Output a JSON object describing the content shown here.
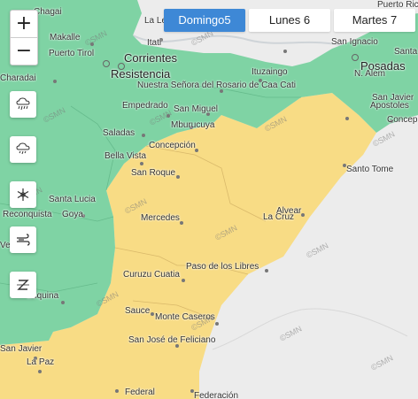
{
  "tabs": [
    {
      "label": "Domingo5",
      "active": true
    },
    {
      "label": "Lunes 6",
      "active": false
    },
    {
      "label": "Martes 7",
      "active": false
    }
  ],
  "zoom": {
    "in_label": "+",
    "out_label": "−"
  },
  "hazard_buttons": [
    {
      "icon": "rain-icon"
    },
    {
      "icon": "storm-icon"
    },
    {
      "icon": "snow-icon"
    },
    {
      "icon": "wind-icon"
    },
    {
      "icon": "zonda-icon"
    }
  ],
  "places": {
    "chagai": "Chagai",
    "la_leonesa": "La Leone",
    "puerto_rico": "Puerto Ric",
    "makalle": "Makalle",
    "puerto_tirol": "Puerto Tirol",
    "itati": "Itati",
    "san_ignacio": "San Ignacio",
    "corrientes": "Corrientes",
    "resistencia": "Resistencia",
    "ituzaingo": "Ituzaingo",
    "posadas": "Posadas",
    "santa_ana": "Santa A",
    "charadai": "Charadai",
    "nuestra_senora": "Nuestra Señora del Rosario de Caa Cati",
    "n_alem": "N. Alem",
    "san_javier_n": "San Javier",
    "apostoles": "Apostoles",
    "concepcion_ne": "Concep",
    "empedrado": "Empedrado",
    "san_miguel": "San Miguel",
    "mburucuya": "Mburucuya",
    "saladas": "Saladas",
    "concepcion": "Concepción",
    "bella_vista": "Bella Vista",
    "santo_tome": "Santo Tome",
    "san_roque": "San Roque",
    "santa_lucia": "Santa Lucia",
    "reconquista": "Reconquista",
    "goya": "Goya",
    "mercedes": "Mercedes",
    "alvear": "Alvear",
    "la_cruz": "La Cruz",
    "paso_libres": "Paso de los Libres",
    "curuzu": "Curuzu Cuatia",
    "vera": "Vera",
    "esquina": "Esquina",
    "sauce": "Sauce",
    "monte_caseros": "Monte Caseros",
    "san_jose_feliciano": "San José de Feliciano",
    "san_javier_s": "San Javier",
    "la_paz": "La Paz",
    "federal": "Federal",
    "federacion": "Federación",
    "watermark": "©SMN"
  },
  "alert_colors": {
    "green": "#7fd3a4",
    "yellow": "#f8dc85",
    "base": "#ececec"
  }
}
